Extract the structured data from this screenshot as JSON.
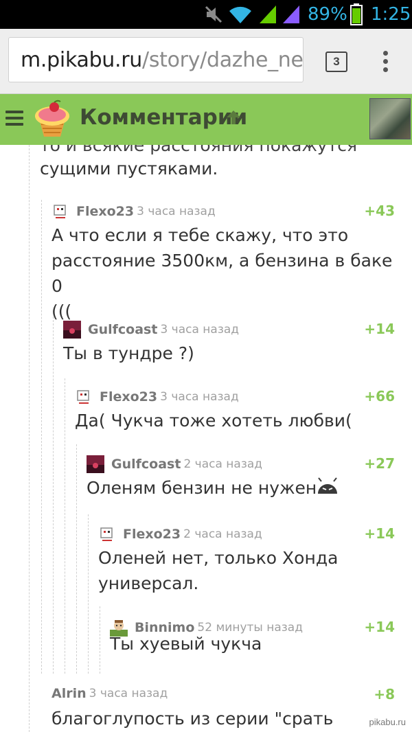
{
  "status_bar": {
    "battery_percent": "89%",
    "time": "1:25"
  },
  "browser": {
    "url_host": "m.pikabu.ru",
    "url_path": "/story/dazhe_ne_",
    "tab_count": "3"
  },
  "header": {
    "title": "Комментарии"
  },
  "top_text": {
    "partial_line": "то и всякие расстояния покажутся",
    "line": "сущими пустяками."
  },
  "comments": [
    {
      "author": "Flexo23",
      "time": "3 часа назад",
      "rating": "+43",
      "text": "А что если я тебе скажу, что это\nрасстояние 3500км, а бензина в баке 0\n((("
    },
    {
      "author": "Gulfcoast",
      "time": "3 часа назад",
      "rating": "+14",
      "text": "Ты в тундре ?)"
    },
    {
      "author": "Flexo23",
      "time": "3 часа назад",
      "rating": "+66",
      "text": "Да( Чукча тоже хотеть любви("
    },
    {
      "author": "Gulfcoast",
      "time": "2 часа назад",
      "rating": "+27",
      "text": "Оленям бензин не нужен"
    },
    {
      "author": "Flexo23",
      "time": "2 часа назад",
      "rating": "+14",
      "text": "Оленей нет, только Хонда\nуниверсал."
    },
    {
      "author": "Binnimo",
      "time": "52 минуты назад",
      "rating": "+14",
      "text": "Ты хуевый чукча"
    },
    {
      "author": "Alrin",
      "time": "3 часа назад",
      "rating": "+8",
      "text": "благоглупость из серии \"срать"
    }
  ],
  "watermark": "pikabu.ru",
  "colors": {
    "header_bg": "#8ac858",
    "rating": "#8ac858",
    "status_icons": "#33b5e5"
  }
}
